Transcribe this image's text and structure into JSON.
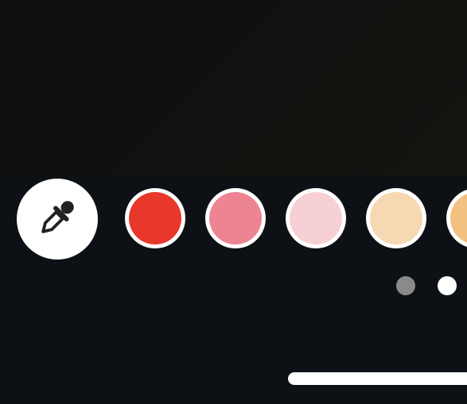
{
  "icons": {
    "eyedropper": "eyedropper-icon"
  },
  "colors": {
    "background": "#0d1014",
    "preview": "#11110f",
    "ring": "#ffffff",
    "dot_inactive": "#8a8a8a",
    "dot_active": "#ffffff"
  },
  "palette": {
    "swatches": [
      {
        "color": "#e8372b"
      },
      {
        "color": "#ed8491"
      },
      {
        "color": "#f6d0d5"
      },
      {
        "color": "#f6d8b2"
      },
      {
        "color": "#f2c180"
      }
    ]
  },
  "pagination": {
    "page_count": 2,
    "active_index": 1
  }
}
